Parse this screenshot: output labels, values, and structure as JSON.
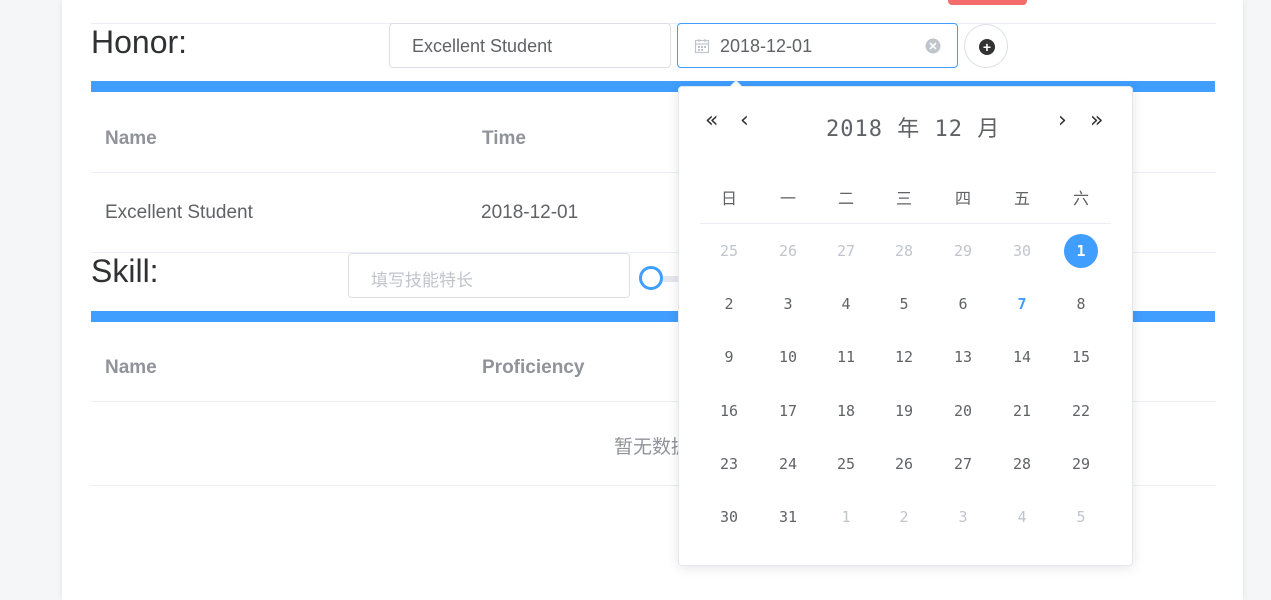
{
  "honor": {
    "label": "Honor:",
    "name_value": "Excellent Student",
    "date_value": "2018-12-01",
    "table": {
      "headers": [
        "Name",
        "Time"
      ],
      "rows": [
        [
          "Excellent Student",
          "2018-12-01"
        ]
      ]
    }
  },
  "skill": {
    "label": "Skill:",
    "placeholder": "填写技能特长",
    "table": {
      "headers": [
        "Name",
        "Proficiency"
      ],
      "empty_text": "暂无数据"
    }
  },
  "datepicker": {
    "year": "2018",
    "year_unit": "年",
    "month": "12",
    "month_unit": "月",
    "nav": {
      "prev_year": "«",
      "prev_month": "‹",
      "next_month": "›",
      "next_year": "»"
    },
    "weekdays": [
      "日",
      "一",
      "二",
      "三",
      "四",
      "五",
      "六"
    ],
    "weeks": [
      [
        "25",
        "26",
        "27",
        "28",
        "29",
        "30",
        "1"
      ],
      [
        "2",
        "3",
        "4",
        "5",
        "6",
        "7",
        "8"
      ],
      [
        "9",
        "10",
        "11",
        "12",
        "13",
        "14",
        "15"
      ],
      [
        "16",
        "17",
        "18",
        "19",
        "20",
        "21",
        "22"
      ],
      [
        "23",
        "24",
        "25",
        "26",
        "27",
        "28",
        "29"
      ],
      [
        "30",
        "31",
        "1",
        "2",
        "3",
        "4",
        "5"
      ]
    ],
    "selected_day": "1",
    "today_day": "7",
    "accent_color": "#409eff"
  },
  "icons": {
    "calendar": "calendar-icon",
    "clear": "circle-close-icon",
    "add": "plus-circle-icon"
  }
}
